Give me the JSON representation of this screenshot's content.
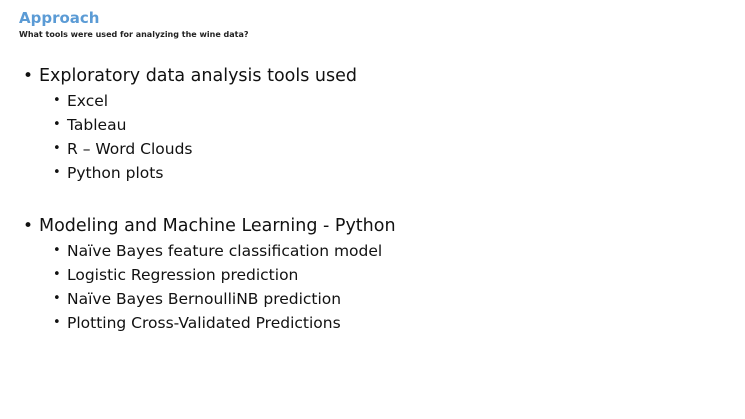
{
  "slide": {
    "title": "Approach",
    "subtitle": "What tools were used for analyzing the wine data?",
    "bullet_glyph": "•",
    "accent_color": "#5b9bd5",
    "sections": [
      {
        "heading": "Exploratory data analysis tools used",
        "items": [
          "Excel",
          "Tableau",
          "R – Word Clouds",
          "Python plots"
        ]
      },
      {
        "heading": "Modeling and Machine Learning - Python",
        "items": [
          "Naïve Bayes feature classification model",
          "Logistic Regression prediction",
          "Naïve Bayes BernoulliNB prediction",
          "Plotting Cross-Validated Predictions"
        ]
      }
    ]
  }
}
